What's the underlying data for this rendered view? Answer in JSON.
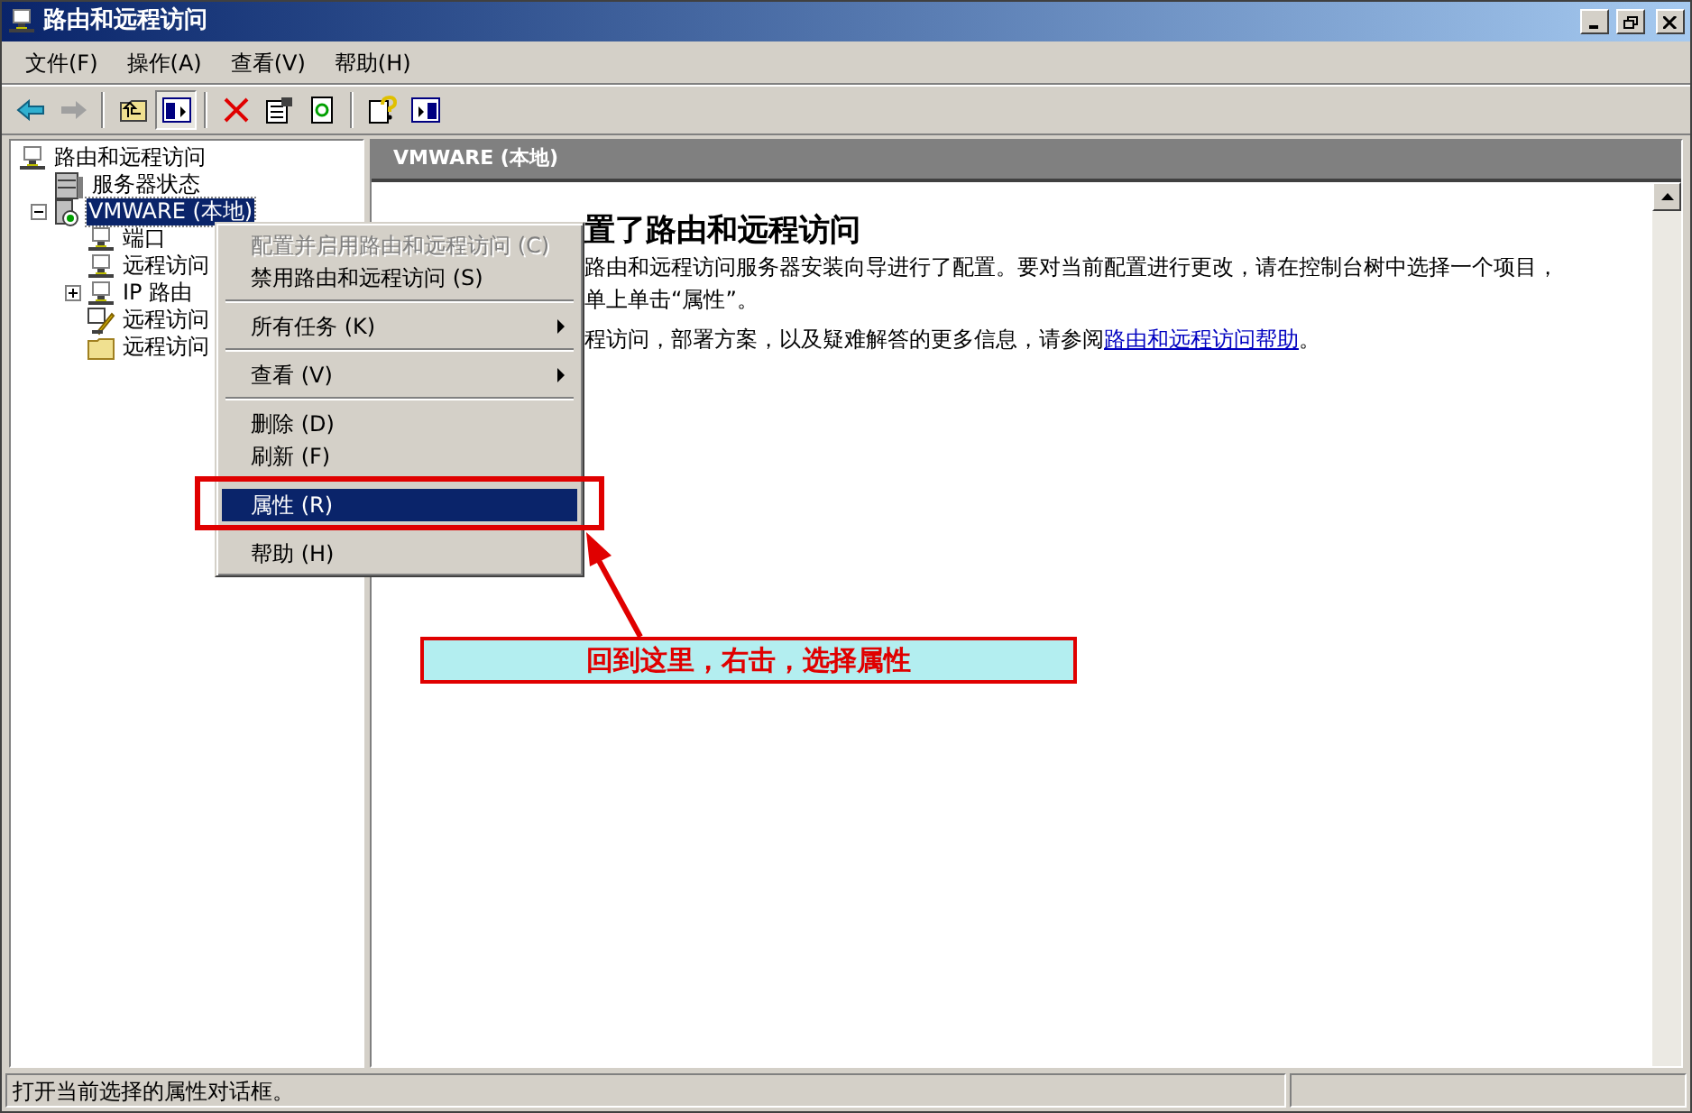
{
  "window": {
    "title": "路由和远程访问"
  },
  "menu_bar": [
    "文件(F)",
    "操作(A)",
    "查看(V)",
    "帮助(H)"
  ],
  "tree": {
    "label": "路由和远程访问",
    "kind": "computer",
    "selected": false,
    "children": [
      {
        "label": "服务器状态",
        "kind": "servers",
        "selected": false
      },
      {
        "label": "VMWARE (本地)",
        "kind": "server",
        "selected": true,
        "expanded": true,
        "children": [
          {
            "label": "端口",
            "kind": "computer",
            "selected": false
          },
          {
            "label": "远程访问",
            "kind": "computer",
            "selected": false
          },
          {
            "label": "IP 路由",
            "kind": "computer",
            "selected": false,
            "expanded": false
          },
          {
            "label": "远程访问",
            "kind": "policy",
            "selected": false
          },
          {
            "label": "远程访问",
            "kind": "folder",
            "selected": false
          }
        ]
      }
    ]
  },
  "details": {
    "header": "VMWARE (本地)",
    "heading": "置了路由和远程访问",
    "lines": [
      "路由和远程访问服务器安装向导进行了配置。要对当前配置进行更改，请在控制台树中选择一个项目，",
      "单上单击“属性”。"
    ],
    "help_text": "程访问，部署方案，以及疑难解答的更多信息，请参阅",
    "help_link": "路由和远程访问帮助",
    "help_end": "。"
  },
  "context_menu": [
    {
      "kind": "item",
      "label": "配置并启用路由和远程访问 (C)",
      "disabled": true,
      "selected": false,
      "submenu": false
    },
    {
      "kind": "item",
      "label": "禁用路由和远程访问 (S)",
      "disabled": false,
      "selected": false,
      "submenu": false
    },
    {
      "kind": "separator"
    },
    {
      "kind": "item",
      "label": "所有任务 (K)",
      "disabled": false,
      "selected": false,
      "submenu": true
    },
    {
      "kind": "separator"
    },
    {
      "kind": "item",
      "label": "查看 (V)",
      "disabled": false,
      "selected": false,
      "submenu": true
    },
    {
      "kind": "separator"
    },
    {
      "kind": "item",
      "label": "删除 (D)",
      "disabled": false,
      "selected": false,
      "submenu": false
    },
    {
      "kind": "item",
      "label": "刷新 (F)",
      "disabled": false,
      "selected": false,
      "submenu": false
    },
    {
      "kind": "separator"
    },
    {
      "kind": "item",
      "label": "属性 (R)",
      "disabled": false,
      "selected": true,
      "submenu": false
    },
    {
      "kind": "separator"
    },
    {
      "kind": "item",
      "label": "帮助 (H)",
      "disabled": false,
      "selected": false,
      "submenu": false
    }
  ],
  "annotation": {
    "callout": "回到这里，右击，选择属性"
  },
  "status_bar": "打开当前选择的属性对话框。"
}
